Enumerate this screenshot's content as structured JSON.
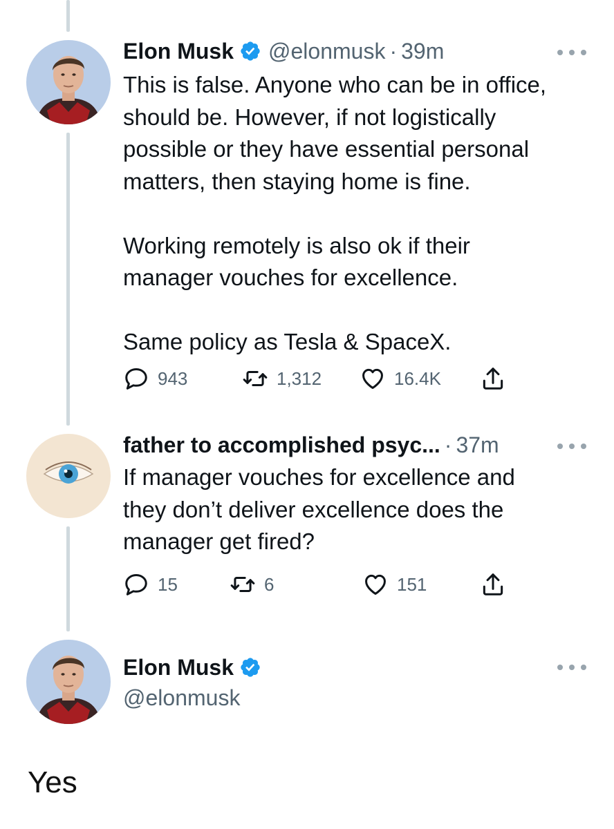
{
  "colors": {
    "verified": "#1d9bf0",
    "secondary_text": "#536471",
    "thread_line": "#cfd9de"
  },
  "tweets": [
    {
      "author_name": "Elon Musk",
      "verified": true,
      "handle": "@elonmusk",
      "separator": "·",
      "time": "39m",
      "text": "This is false. Anyone who can be in office,\nshould be. However, if not logistically\npossible or they have essential personal\nmatters, then staying home is fine.\n\nWorking remotely is also ok if their\nmanager vouches for excellence.\n\nSame policy as Tesla & SpaceX.",
      "replies": "943",
      "retweets": "1,312",
      "likes": "16.4K"
    },
    {
      "author_name": "father to accomplished psyc...",
      "verified": false,
      "handle": "",
      "separator": "·",
      "time": "37m",
      "text": "If manager vouches for excellence and\nthey don’t deliver excellence does the\nmanager get fired?",
      "replies": "15",
      "retweets": "6",
      "likes": "151"
    },
    {
      "author_name": "Elon Musk",
      "verified": true,
      "handle": "@elonmusk"
    }
  ],
  "reply_text": "Yes",
  "icons": [
    "reply-icon",
    "retweet-icon",
    "like-icon",
    "share-icon",
    "verified-badge-icon",
    "more-icon"
  ]
}
